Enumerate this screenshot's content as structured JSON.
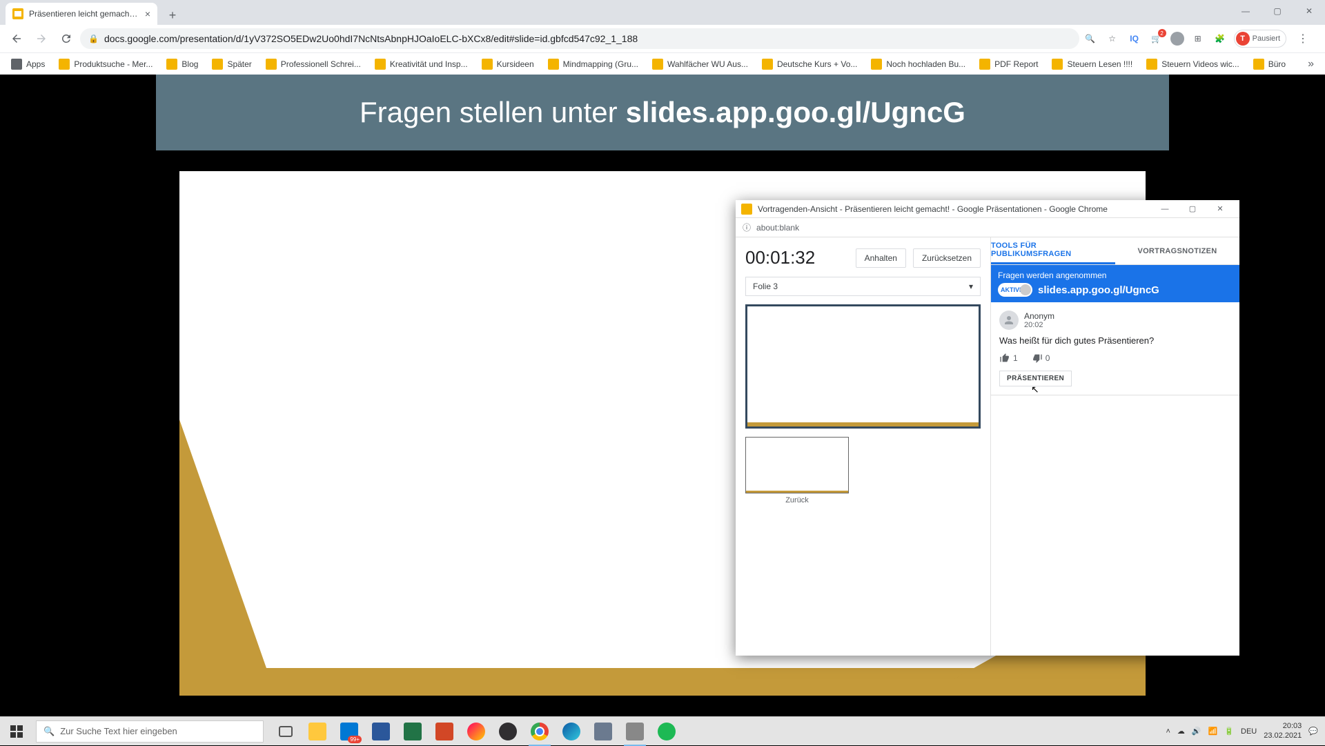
{
  "browser": {
    "tab_title": "Präsentieren leicht gemacht! - G",
    "url": "docs.google.com/presentation/d/1yV372SO5EDw2Uo0hdI7NcNtsAbnpHJOaIoELC-bXCx8/edit#slide=id.gbfcd547c92_1_188",
    "profile_label": "Pausiert",
    "profile_initial": "T",
    "bookmarks": [
      "Apps",
      "Produktsuche - Mer...",
      "Blog",
      "Später",
      "Professionell Schrei...",
      "Kreativität und Insp...",
      "Kursideen",
      "Mindmapping  (Gru...",
      "Wahlfächer WU Aus...",
      "Deutsche Kurs + Vo...",
      "Noch hochladen Bu...",
      "PDF Report",
      "Steuern Lesen !!!!",
      "Steuern Videos wic...",
      "Büro"
    ]
  },
  "qa_banner": {
    "prefix": "Fragen stellen unter",
    "url": "slides.app.goo.gl/UgncG"
  },
  "popup": {
    "title": "Vortragenden-Ansicht - Präsentieren leicht gemacht! - Google Präsentationen - Google Chrome",
    "addr": "about:blank",
    "timer": "00:01:32",
    "pause_btn": "Anhalten",
    "reset_btn": "Zurücksetzen",
    "slide_sel": "Folie 3",
    "back_label": "Zurück",
    "tabs": {
      "qa": "TOOLS FÜR PUBLIKUMSFRAGEN",
      "notes": "VORTRAGSNOTIZEN"
    },
    "qa": {
      "accepting": "Fragen werden angenommen",
      "toggle_label": "AKTIVIE",
      "url": "slides.app.goo.gl/UgncG"
    },
    "question": {
      "author": "Anonym",
      "time": "20:02",
      "text": "Was heißt für dich gutes Präsentieren?",
      "upvotes": "1",
      "downvotes": "0",
      "present_btn": "PRÄSENTIEREN"
    }
  },
  "taskbar": {
    "search_placeholder": "Zur Suche Text hier eingeben",
    "lang": "DEU",
    "time": "20:03",
    "date": "23.02.2021",
    "badge": "99+"
  }
}
